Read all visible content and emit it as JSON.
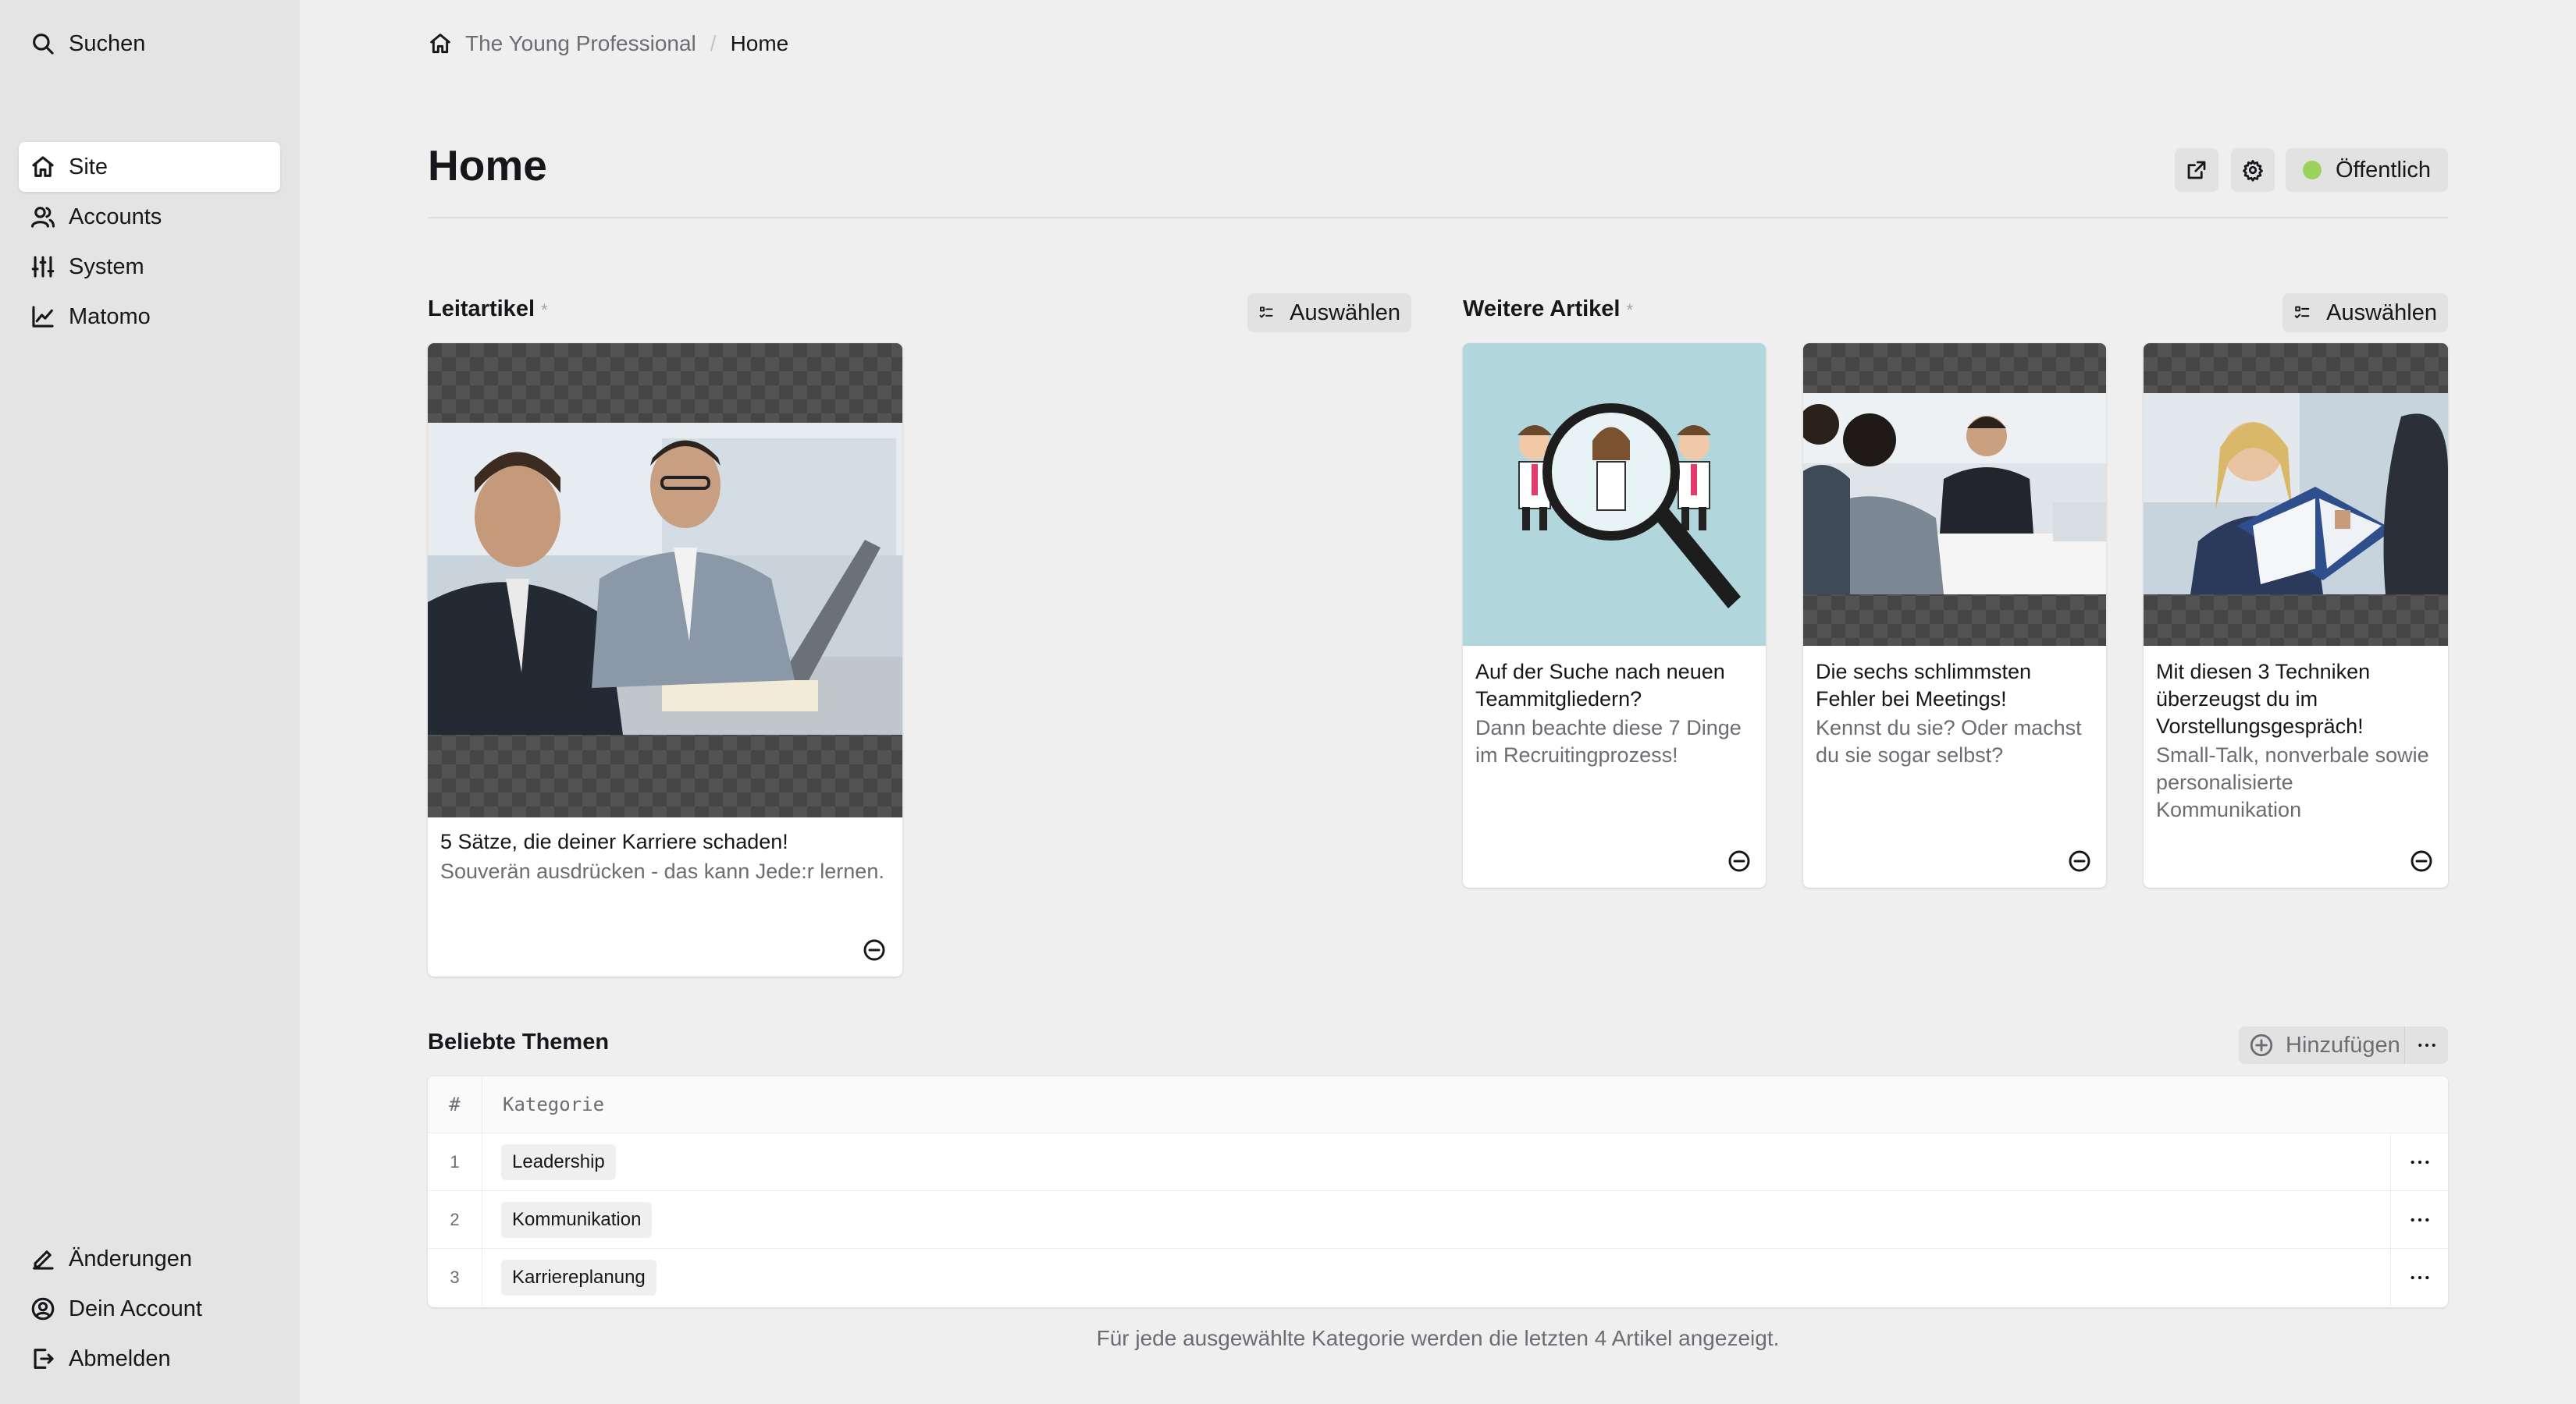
{
  "sidebar": {
    "search_label": "Suchen",
    "nav": [
      {
        "label": "Site",
        "icon": "home-icon",
        "active": true
      },
      {
        "label": "Accounts",
        "icon": "users-icon"
      },
      {
        "label": "System",
        "icon": "sliders-icon"
      },
      {
        "label": "Matomo",
        "icon": "chart-icon"
      }
    ],
    "bottom": [
      {
        "label": "Änderungen",
        "icon": "edit-icon"
      },
      {
        "label": "Dein Account",
        "icon": "user-circle-icon"
      },
      {
        "label": "Abmelden",
        "icon": "logout-icon"
      }
    ]
  },
  "breadcrumb": {
    "items": [
      "The Young Professional",
      "Home"
    ],
    "separator": "/"
  },
  "page": {
    "title": "Home",
    "status_label": "Öffentlich",
    "status_color": "#9bd35a"
  },
  "leitartikel": {
    "label": "Leitartikel",
    "required_mark": "*",
    "select_label": "Auswählen",
    "card": {
      "title": "5 Sätze, die deiner Karriere schaden!",
      "description": "Souverän ausdrücken - das kann Jede:r lernen."
    }
  },
  "weitere": {
    "label": "Weitere Artikel",
    "required_mark": "*",
    "select_label": "Auswählen",
    "cards": [
      {
        "title": "Auf der Suche nach neuen Teammitgliedern?",
        "description": "Dann beachte diese 7 Dinge im Recruitingprozess!"
      },
      {
        "title": "Die sechs schlimmsten Fehler bei Meetings!",
        "description": "Kennst du sie? Oder machst du sie sogar selbst?"
      },
      {
        "title": "Mit diesen 3 Techniken überzeugst du im Vorstellungsgespräch!",
        "description": "Small-Talk, nonverbale sowie personalisierte Kommunikation"
      }
    ]
  },
  "themen": {
    "label": "Beliebte Themen",
    "add_label": "Hinzufügen",
    "columns": [
      "#",
      "Kategorie"
    ],
    "rows": [
      {
        "index": "1",
        "category": "Leadership"
      },
      {
        "index": "2",
        "category": "Kommunikation"
      },
      {
        "index": "3",
        "category": "Karriereplanung"
      }
    ],
    "help": "Für jede ausgewählte Kategorie werden die letzten 4 Artikel angezeigt."
  }
}
